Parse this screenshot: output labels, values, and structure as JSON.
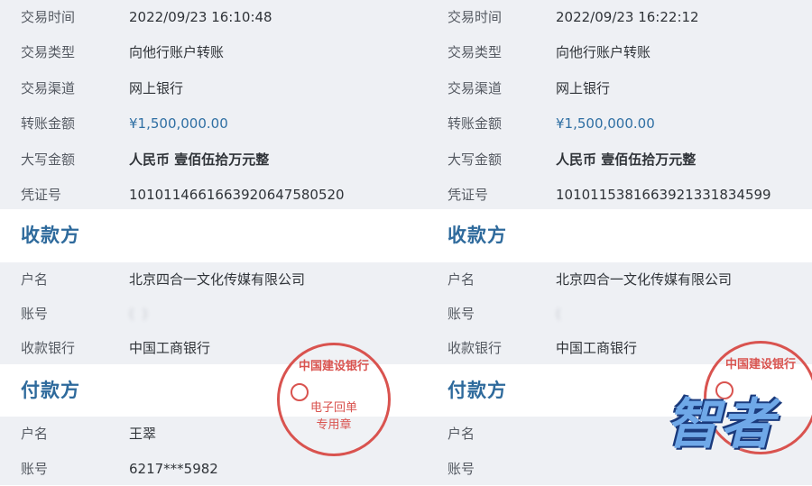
{
  "left": {
    "rows": [
      {
        "label": "交易时间",
        "value": "2022/09/23 16:10:48"
      },
      {
        "label": "交易类型",
        "value": "向他行账户转账"
      },
      {
        "label": "交易渠道",
        "value": "网上银行"
      },
      {
        "label": "转账金额",
        "value": "¥1,500,000.00"
      },
      {
        "label": "大写金额",
        "value": "人民币 壹佰伍拾万元整"
      },
      {
        "label": "凭证号",
        "value": "1010114661663920647580520"
      }
    ],
    "payee_header": "收款方",
    "payee": [
      {
        "label": "户名",
        "value": "北京四合一文化传媒有限公司"
      },
      {
        "label": "账号",
        "value": "(                     )"
      },
      {
        "label": "收款银行",
        "value": "中国工商银行"
      }
    ],
    "payer_header": "付款方",
    "payer": [
      {
        "label": "户名",
        "value": "王翠"
      },
      {
        "label": "账号",
        "value": "6217***5982"
      }
    ]
  },
  "right": {
    "rows": [
      {
        "label": "交易时间",
        "value": "2022/09/23 16:22:12"
      },
      {
        "label": "交易类型",
        "value": "向他行账户转账"
      },
      {
        "label": "交易渠道",
        "value": "网上银行"
      },
      {
        "label": "转账金额",
        "value": "¥1,500,000.00"
      },
      {
        "label": "大写金额",
        "value": "人民币 壹佰伍拾万元整"
      },
      {
        "label": "凭证号",
        "value": "1010115381663921331834599"
      }
    ],
    "payee_header": "收款方",
    "payee": [
      {
        "label": "户名",
        "value": "北京四合一文化传媒有限公司"
      },
      {
        "label": "账号",
        "value": "(                       "
      },
      {
        "label": "收款银行",
        "value": "中国工商银行"
      }
    ],
    "payer_header": "付款方",
    "payer": [
      {
        "label": "户名",
        "value": ""
      },
      {
        "label": "账号",
        "value": ""
      }
    ]
  },
  "stamp": {
    "arc_text": "中国建设银行",
    "line1": "电子回单",
    "line2": "专用章",
    "color": "#d9534f"
  },
  "watermark": {
    "text": "智者"
  },
  "colors": {
    "header": "#2e6a9c",
    "amount": "#2f6fa3",
    "block_bg": "#eef0f4"
  }
}
